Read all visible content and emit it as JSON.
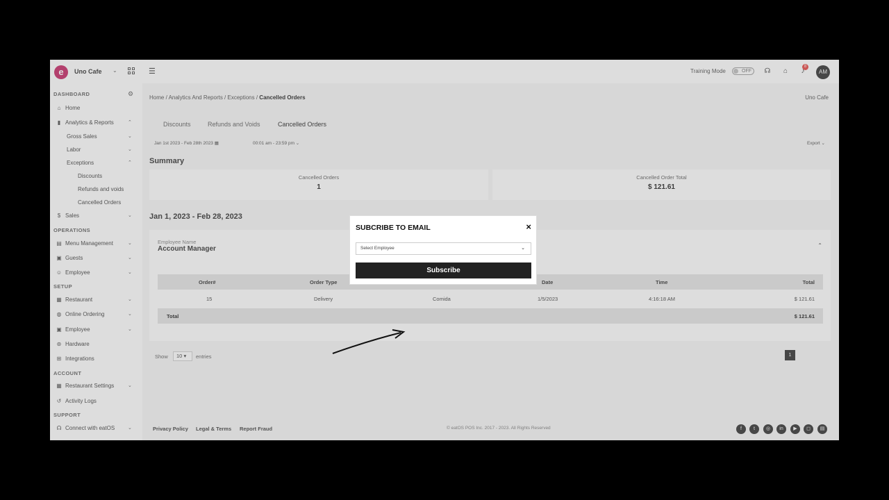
{
  "app": {
    "logo_letter": "e",
    "store_name": "Uno Cafe"
  },
  "topbar": {
    "training_label": "Training Mode",
    "toggle_state": "OFF",
    "notification_count": "8",
    "avatar_initials": "AM"
  },
  "sidebar": {
    "dashboard_heading": "DASHBOARD",
    "home": "Home",
    "analytics": "Analytics & Reports",
    "gross_sales": "Gross Sales",
    "labor": "Labor",
    "exceptions": "Exceptions",
    "discounts": "Discounts",
    "refunds": "Refunds and voids",
    "cancelled": "Cancelled Orders",
    "sales": "Sales",
    "operations_heading": "OPERATIONS",
    "menu_management": "Menu Management",
    "guests": "Guests",
    "employee": "Employee",
    "setup_heading": "SETUP",
    "restaurant": "Restaurant",
    "online_ordering": "Online Ordering",
    "employee2": "Employee",
    "hardware": "Hardware",
    "integrations": "Integrations",
    "account_heading": "ACCOUNT",
    "restaurant_settings": "Restaurant Settings",
    "activity_logs": "Activity Logs",
    "support_heading": "SUPPORT",
    "connect": "Connect with eatOS"
  },
  "breadcrumb": {
    "path": "Home / Analytics And Reports / Exceptions / ",
    "current": "Cancelled Orders",
    "right": "Uno Cafe"
  },
  "tabs": [
    "Discounts",
    "Refunds and Voids",
    "Cancelled Orders"
  ],
  "filters": {
    "date_range": "Jan 1st 2023 - Feb 28th 2023",
    "time_range": "00:01 am - 23:59 pm",
    "export": "Export"
  },
  "summary": {
    "title": "Summary",
    "cards": [
      {
        "label": "Cancelled Orders",
        "value": "1"
      },
      {
        "label": "Cancelled Order Total",
        "value": "$ 121.61"
      }
    ]
  },
  "period_title": "Jan 1, 2023 - Feb 28, 2023",
  "employee_block": {
    "label": "Employee Name",
    "name": "Account Manager"
  },
  "table": {
    "headers": [
      "Order#",
      "Order Type",
      "Date",
      "Time",
      "Total"
    ],
    "row": {
      "order": "15",
      "type": "Delivery",
      "source": "Comida",
      "date": "1/5/2023",
      "time": "4:16:18 AM",
      "total": "$ 121.61"
    },
    "total_label": "Total",
    "total_value": "$ 121.61"
  },
  "pagination": {
    "show": "Show",
    "page_size": "10",
    "entries": "entries",
    "page": "1"
  },
  "footer": {
    "privacy": "Privacy Policy",
    "legal": "Legal & Terms",
    "fraud": "Report Fraud",
    "copyright": "© eatOS POS Inc. 2017 - 2023. All Rights Reserved"
  },
  "modal": {
    "title": "SUBCRIBE TO EMAIL",
    "close": "×",
    "select_placeholder": "Select Employee",
    "button": "Subscribe"
  },
  "social_icons": [
    "facebook-icon",
    "twitter-icon",
    "instagram-icon",
    "linkedin-icon",
    "youtube-icon",
    "instagram-alt-icon",
    "blog-icon"
  ]
}
